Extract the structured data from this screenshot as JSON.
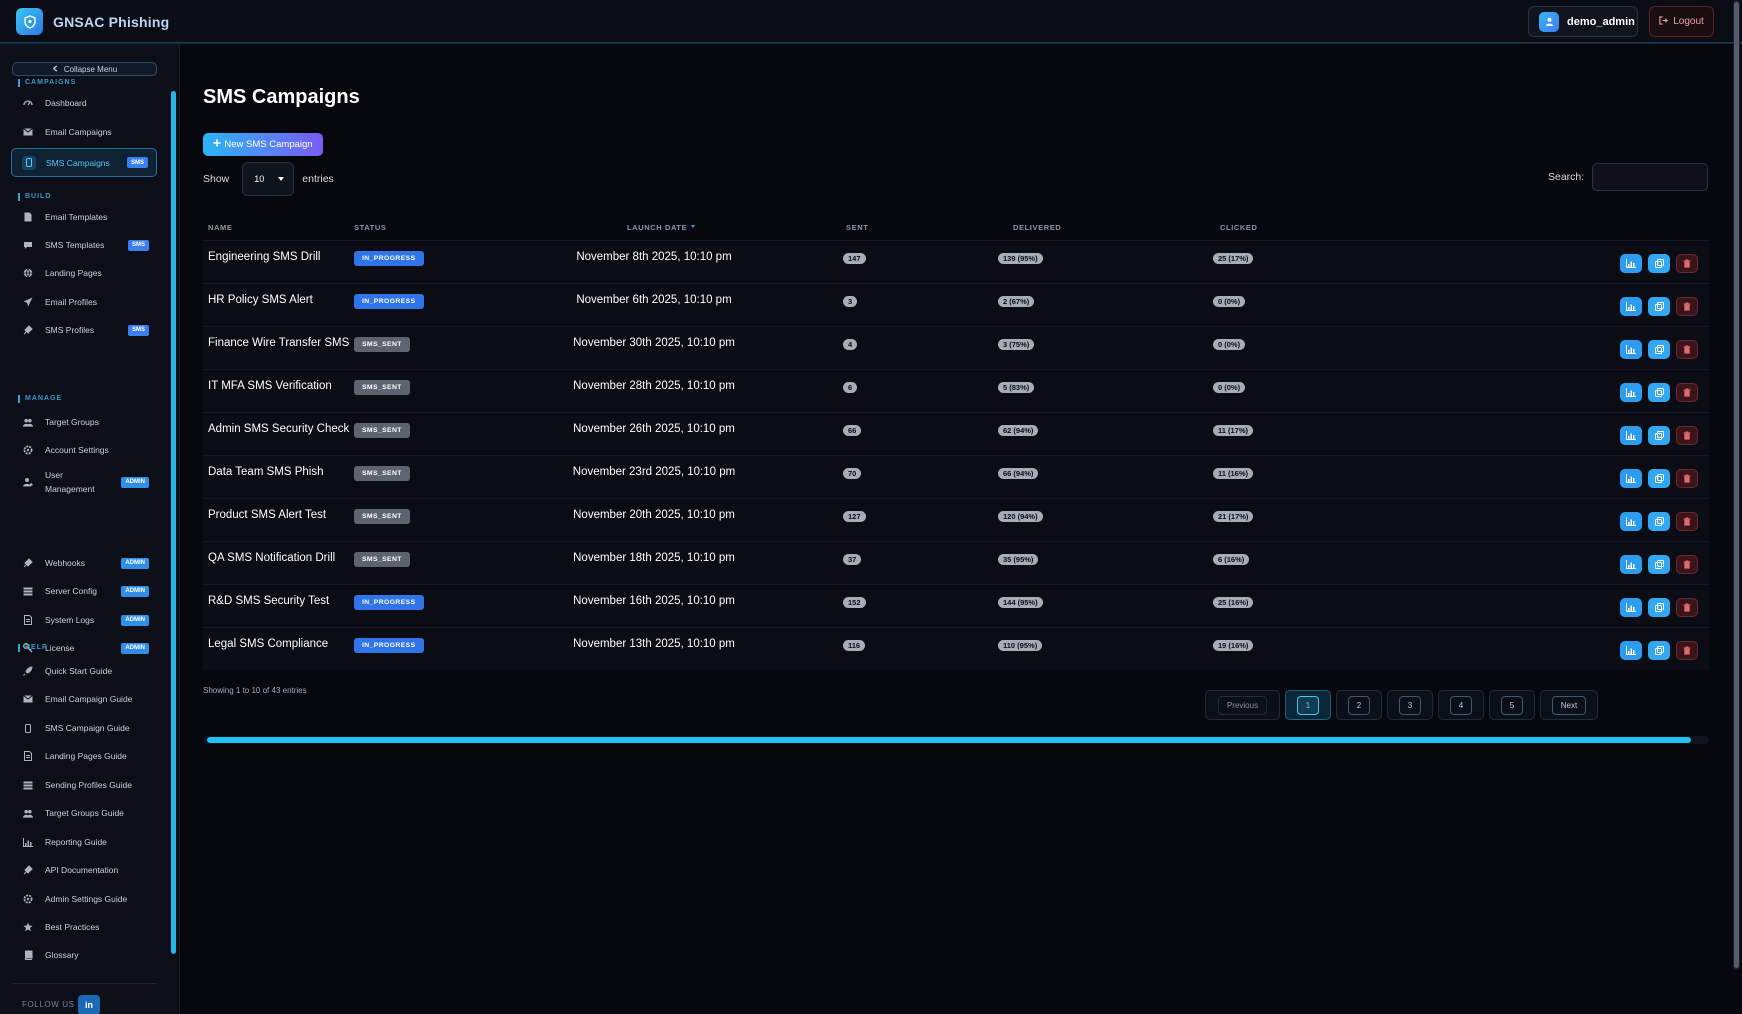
{
  "app": {
    "title": "GNSAC Phishing",
    "user": "demo_admin",
    "logout": "Logout"
  },
  "sidebar": {
    "collapse": "Collapse Menu",
    "sections": {
      "campaigns": "CAMPAIGNS",
      "build": "BUILD",
      "manage": "MANAGE",
      "help": "HELP"
    },
    "items": {
      "dashboard": "Dashboard",
      "email_campaigns": "Email Campaigns",
      "sms_campaigns": "SMS Campaigns",
      "email_templates": "Email Templates",
      "sms_templates": "SMS Templates",
      "landing_pages": "Landing Pages",
      "email_profiles": "Email Profiles",
      "sms_profiles": "SMS Profiles",
      "target_groups": "Target Groups",
      "account_settings": "Account Settings",
      "user_management": "User Management",
      "webhooks": "Webhooks",
      "server_config": "Server Config",
      "system_logs": "System Logs",
      "license": "License",
      "quick_start": "Quick Start Guide",
      "email_campaign_guide": "Email Campaign Guide",
      "sms_campaign_guide": "SMS Campaign Guide",
      "landing_pages_guide": "Landing Pages Guide",
      "sending_profiles_guide": "Sending Profiles Guide",
      "target_groups_guide": "Target Groups Guide",
      "reporting_guide": "Reporting Guide",
      "api_docs": "API Documentation",
      "admin_settings_guide": "Admin Settings Guide",
      "best_practices": "Best Practices",
      "glossary": "Glossary"
    },
    "badges": {
      "sms": "SMS",
      "admin": "ADMIN"
    },
    "follow": "FOLLOW US",
    "linkedin": "in"
  },
  "main": {
    "title": "SMS Campaigns",
    "new_button": "New SMS Campaign",
    "show_label": "Show",
    "show_value": "10",
    "entries_label": "entries",
    "search_label": "Search:",
    "search_value": "",
    "columns": {
      "name": "NAME",
      "status": "STATUS",
      "launch_date": "LAUNCH DATE",
      "sent": "SENT",
      "delivered": "DELIVERED",
      "clicked": "CLICKED"
    },
    "rows": [
      {
        "name": "Engineering SMS Drill",
        "status": "IN_PROGRESS",
        "date": "November 8th 2025, 10:10 pm",
        "sent": "147",
        "delivered": "139 (95%)",
        "clicked": "25 (17%)"
      },
      {
        "name": "HR Policy SMS Alert",
        "status": "IN_PROGRESS",
        "date": "November 6th 2025, 10:10 pm",
        "sent": "3",
        "delivered": "2 (67%)",
        "clicked": "0 (0%)"
      },
      {
        "name": "Finance Wire Transfer SMS",
        "status": "SMS_SENT",
        "date": "November 30th 2025, 10:10 pm",
        "sent": "4",
        "delivered": "3 (75%)",
        "clicked": "0 (0%)"
      },
      {
        "name": "IT MFA SMS Verification",
        "status": "SMS_SENT",
        "date": "November 28th 2025, 10:10 pm",
        "sent": "6",
        "delivered": "5 (83%)",
        "clicked": "0 (0%)"
      },
      {
        "name": "Admin SMS Security Check",
        "status": "SMS_SENT",
        "date": "November 26th 2025, 10:10 pm",
        "sent": "66",
        "delivered": "62 (94%)",
        "clicked": "11 (17%)"
      },
      {
        "name": "Data Team SMS Phish",
        "status": "SMS_SENT",
        "date": "November 23rd 2025, 10:10 pm",
        "sent": "70",
        "delivered": "66 (94%)",
        "clicked": "11 (16%)"
      },
      {
        "name": "Product SMS Alert Test",
        "status": "SMS_SENT",
        "date": "November 20th 2025, 10:10 pm",
        "sent": "127",
        "delivered": "120 (94%)",
        "clicked": "21 (17%)"
      },
      {
        "name": "QA SMS Notification Drill",
        "status": "SMS_SENT",
        "date": "November 18th 2025, 10:10 pm",
        "sent": "37",
        "delivered": "35 (95%)",
        "clicked": "6 (16%)"
      },
      {
        "name": "R&D SMS Security Test",
        "status": "IN_PROGRESS",
        "date": "November 16th 2025, 10:10 pm",
        "sent": "152",
        "delivered": "144 (95%)",
        "clicked": "25 (16%)"
      },
      {
        "name": "Legal SMS Compliance",
        "status": "IN_PROGRESS",
        "date": "November 13th 2025, 10:10 pm",
        "sent": "116",
        "delivered": "110 (95%)",
        "clicked": "19 (16%)"
      }
    ],
    "info": "Showing 1 to 10 of 43 entries",
    "pagination": {
      "previous": "Previous",
      "pages": [
        "1",
        "2",
        "3",
        "4",
        "5"
      ],
      "next": "Next",
      "current": "1"
    }
  }
}
